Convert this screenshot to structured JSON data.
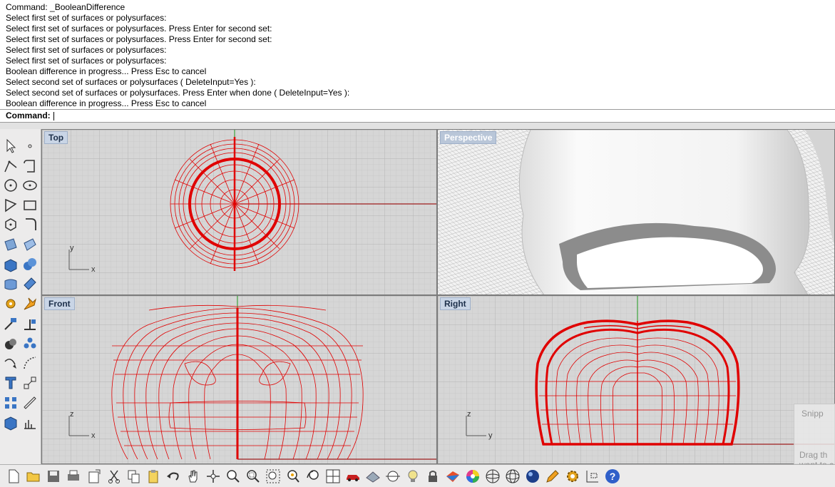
{
  "history": [
    "Command: _BooleanDifference",
    "Select first set of surfaces or polysurfaces:",
    "Select first set of surfaces or polysurfaces. Press Enter for second set:",
    "Select first set of surfaces or polysurfaces. Press Enter for second set:",
    "Select first set of surfaces or polysurfaces:",
    "Select first set of surfaces or polysurfaces:",
    "Boolean difference in progress... Press Esc to cancel",
    "Select second set of surfaces or polysurfaces ( DeleteInput=Yes ):",
    "Select second set of surfaces or polysurfaces. Press Enter when done ( DeleteInput=Yes ):",
    "Boolean difference in progress... Press Esc to cancel"
  ],
  "command": {
    "label": "Command:",
    "value": ""
  },
  "viewports": {
    "top": {
      "label": "Top",
      "axis1": "x",
      "axis2": "y"
    },
    "perspective": {
      "label": "Perspective"
    },
    "front": {
      "label": "Front",
      "axis1": "x",
      "axis2": "z"
    },
    "right": {
      "label": "Right",
      "axis1": "y",
      "axis2": "z"
    }
  },
  "notification": {
    "title": "Snipp",
    "line1": "Drag th",
    "line2": "want to c"
  },
  "colors": {
    "wire": "#e00000",
    "grid": "#c8c8c8",
    "viewport_bg": "#d6d6d6",
    "label_bg": "#c9d5e6"
  },
  "left_toolbar_icons": [
    "select-arrow-icon",
    "point-icon",
    "polyline-icon",
    "curve-icon",
    "circle-icon",
    "arc-icon",
    "polygon-icon",
    "rectangle-icon",
    "ellipse-icon",
    "fillet-icon",
    "surface-icon",
    "surface-edit-icon",
    "box-icon",
    "sphere-icon",
    "extrude-icon",
    "plane-icon",
    "gear-icon",
    "explode-icon",
    "split-icon",
    "trim-icon",
    "boolean-icon",
    "group-icon",
    "curve-tools-icon",
    "rebuild-icon",
    "text-icon",
    "scale-icon",
    "array-icon",
    "dimension-icon",
    "solid-box-icon",
    "analyze-icon"
  ],
  "bottom_toolbar_icons": [
    "new-file-icon",
    "open-folder-icon",
    "save-icon",
    "print-icon",
    "import-icon",
    "cut-icon",
    "copy-icon",
    "paste-icon",
    "undo-icon",
    "pan-hand-icon",
    "rotate-view-icon",
    "zoom-icon",
    "zoom-window-icon",
    "zoom-extents-icon",
    "zoom-selected-icon",
    "undo-view-icon",
    "four-viewports-icon",
    "car-icon",
    "texture-icon",
    "osnap-icon",
    "light-bulb-icon",
    "lock-icon",
    "layer-icon",
    "color-wheel-icon",
    "sphere-grid-icon",
    "wireframe-sphere-icon",
    "render-sphere-icon",
    "pencil-icon",
    "settings-gear-icon",
    "dimension-tool-icon",
    "help-icon"
  ]
}
